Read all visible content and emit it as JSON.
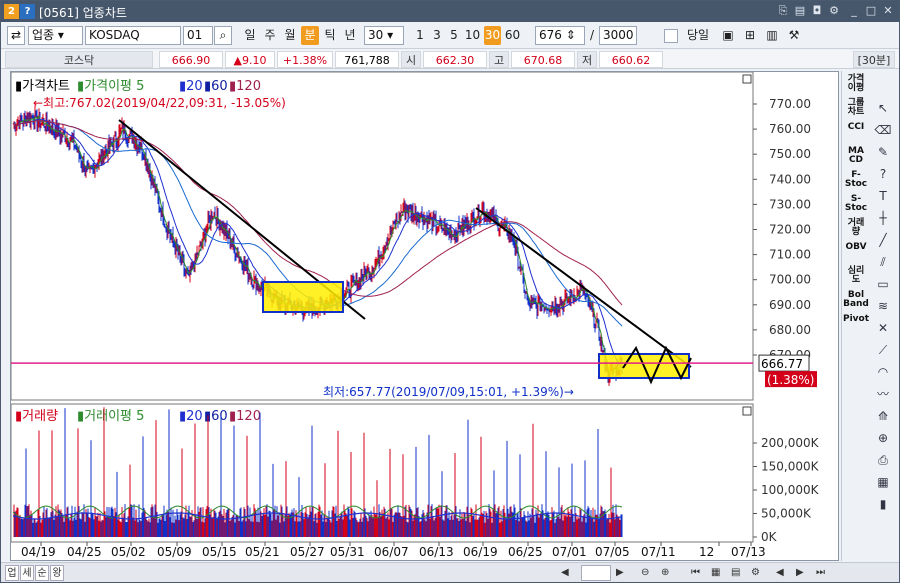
{
  "title": {
    "code": "[0561]",
    "name": "업종차트"
  },
  "toolbar": {
    "type_select": "업종",
    "symbol": "KOSDAQ",
    "code": "01",
    "period_buttons": [
      "일",
      "주",
      "월",
      "분",
      "틱",
      "년"
    ],
    "selected_period": "분",
    "interval_value": "30",
    "interval_buttons": [
      "1",
      "3",
      "5",
      "10",
      "30",
      "60"
    ],
    "selected_interval": "30",
    "count_value": "676",
    "total_value": "3000",
    "same_day_label": "당일"
  },
  "quote": {
    "name": "코스닥",
    "price": "666.90",
    "change": "▲9.10",
    "change_pct": "+1.38%",
    "volume": "761,788",
    "open_label": "시",
    "open": "662.30",
    "high_label": "고",
    "high": "670.68",
    "low_label": "저",
    "low": "660.62",
    "timeframe": "[30분]"
  },
  "price_panel": {
    "legend_title": "가격차트",
    "legend_ma_label": "가격이평",
    "legend_ma": [
      "5",
      "20",
      "60",
      "120"
    ],
    "high_note": "←최고:767.02(2019/04/22,09:31, -13.05%)",
    "low_note": "최저:657.77(2019/07/09,15:01, +1.39%)→",
    "current_price": "666.77",
    "current_pct": "(1.38%)",
    "y_labels": [
      "770.00",
      "760.00",
      "750.00",
      "740.00",
      "730.00",
      "720.00",
      "710.00",
      "700.00",
      "690.00",
      "680.00",
      "670.00"
    ]
  },
  "volume_panel": {
    "legend_title": "거래량",
    "legend_ma_label": "거래이평",
    "legend_ma": [
      "5",
      "20",
      "60",
      "120"
    ],
    "y_labels": [
      "200,000K",
      "150,000K",
      "100,000K",
      "50,000K",
      "0K"
    ]
  },
  "x_labels": [
    "04/19",
    "04/25",
    "05/02",
    "05/09",
    "05/15",
    "05/21",
    "05/27",
    "05/31",
    "06/07",
    "06/13",
    "06/19",
    "06/25",
    "07/01",
    "07/05",
    "07/11",
    "12",
    "07/13"
  ],
  "right_indicators": [
    "가격\n이평",
    "그룹\n차트",
    "CCI",
    "MA\nCD",
    "F-\nStoc",
    "S-\nStoc",
    "거래\n량",
    "OBV",
    "심리\n도",
    "Bol\nBand",
    "Pivot"
  ],
  "bottom_tabs": [
    "업",
    "세",
    "순",
    "왕"
  ],
  "colors": {
    "up": "#d4001a",
    "down": "#1030c8",
    "ma5": "#2e8b2e",
    "ma20": "#2030d0",
    "ma60": "#1a6ad0",
    "ma120": "#a02050",
    "box_fill": "#ffef00"
  }
}
